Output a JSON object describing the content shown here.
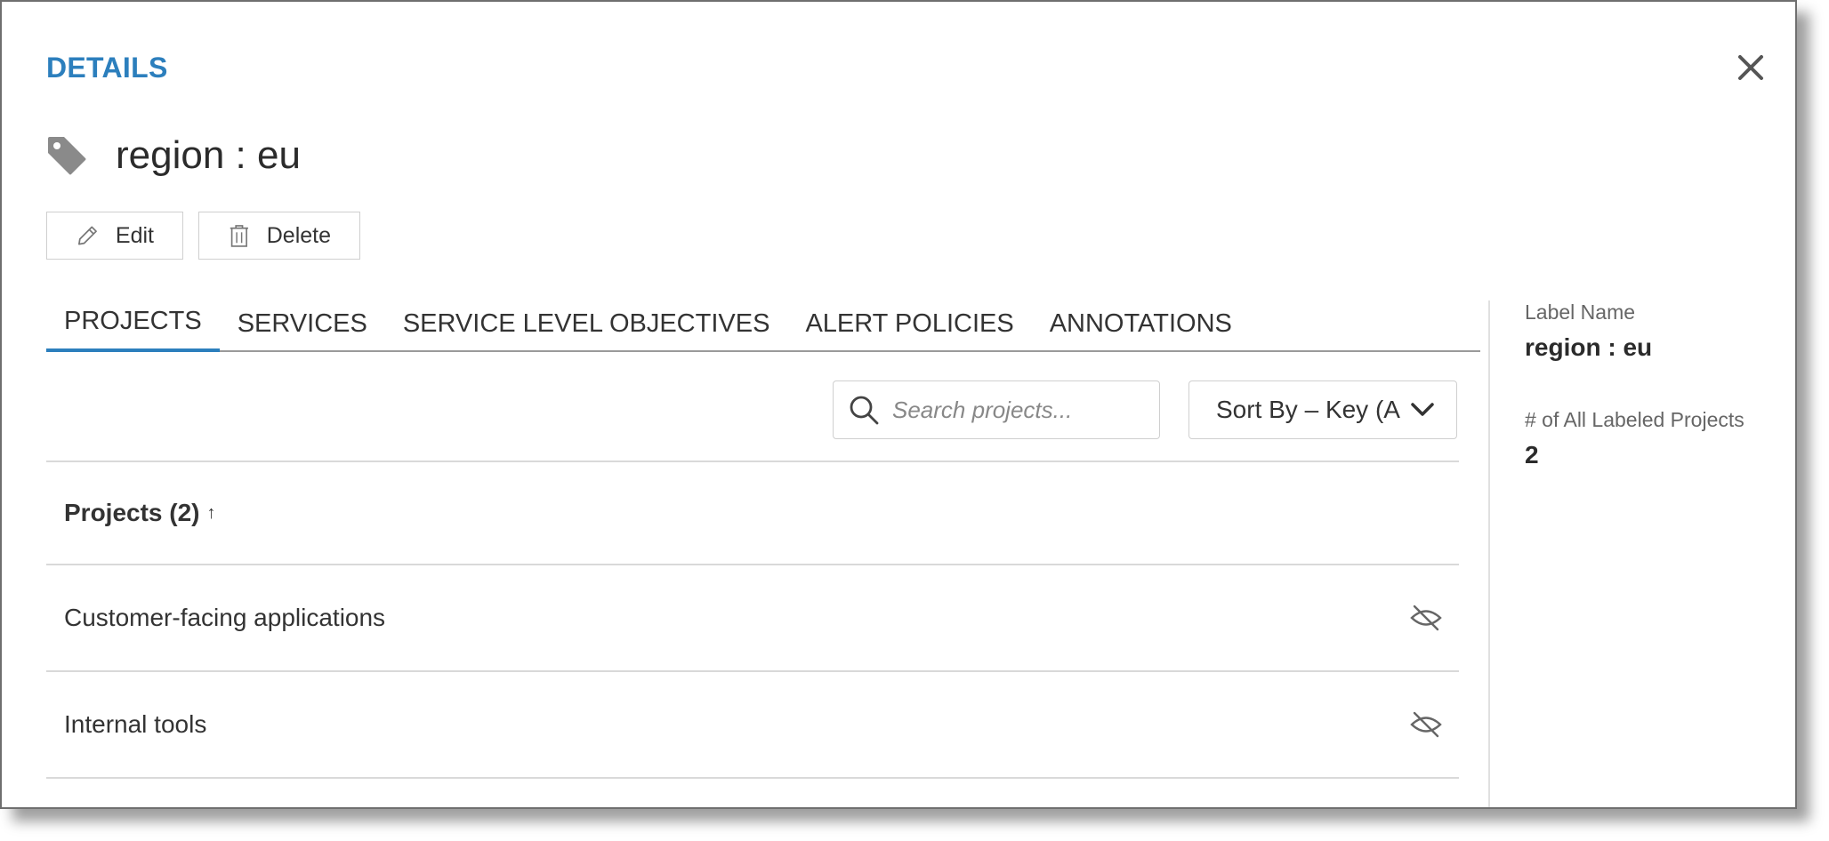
{
  "header": {
    "title": "DETAILS",
    "label_title": "region : eu"
  },
  "actions": {
    "edit_label": "Edit",
    "delete_label": "Delete"
  },
  "tabs": [
    {
      "label": "PROJECTS",
      "active": true
    },
    {
      "label": "SERVICES",
      "active": false
    },
    {
      "label": "SERVICE LEVEL OBJECTIVES",
      "active": false
    },
    {
      "label": "ALERT POLICIES",
      "active": false
    },
    {
      "label": "ANNOTATIONS",
      "active": false
    }
  ],
  "search": {
    "placeholder": "Search projects...",
    "value": ""
  },
  "sort": {
    "selected": "Sort By – Key (A"
  },
  "table": {
    "header": "Projects (2)",
    "sort_arrow": "↑",
    "rows": [
      {
        "name": "Customer-facing applications",
        "icon": "eye-slash-icon"
      },
      {
        "name": "Internal tools",
        "icon": "eye-slash-icon"
      }
    ]
  },
  "sidebar": {
    "label_name_title": "Label Name",
    "label_name_value": "region : eu",
    "count_title": "# of All Labeled Projects",
    "count_value": "2"
  },
  "colors": {
    "accent": "#2c7fbd",
    "text": "#333333",
    "icon_gray": "#8a8a8a"
  }
}
